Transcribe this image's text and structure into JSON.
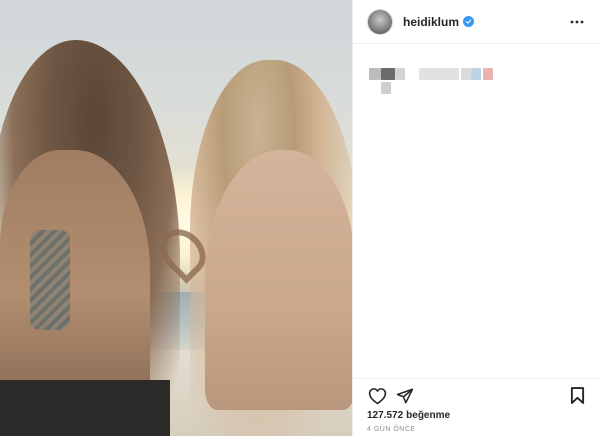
{
  "post": {
    "username": "heidiklum",
    "verified": true,
    "caption_blurred": true,
    "likes_count": "127.572",
    "likes_word": "beğenme",
    "timestamp": "4 GÜN ÖNCE"
  },
  "icons": {
    "more": "more-horizontal-icon",
    "like": "heart-icon",
    "share": "paper-plane-icon",
    "save": "bookmark-icon",
    "verified": "verified-badge-icon"
  },
  "colors": {
    "verified_blue": "#3897f0",
    "text_primary": "#262626",
    "text_secondary": "#8e8e8e",
    "divider": "#efefef"
  }
}
